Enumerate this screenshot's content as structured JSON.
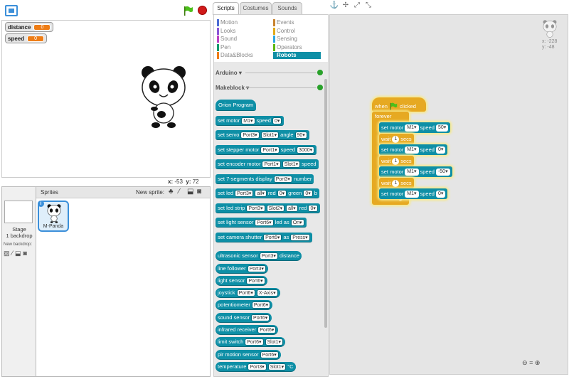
{
  "stage": {
    "variables": [
      {
        "name": "distance",
        "value": "0"
      },
      {
        "name": "speed",
        "value": "0"
      }
    ],
    "coords": {
      "x_label": "x:",
      "x": "-53",
      "y_label": "y:",
      "y": "72"
    }
  },
  "sprites": {
    "header": "Sprites",
    "new_sprite_label": "New sprite:",
    "stage_label_1": "Stage",
    "stage_label_2": "1 backdrop",
    "new_backdrop_label": "New backdrop:",
    "items": [
      {
        "name": "M-Panda"
      }
    ],
    "info_badge": "i"
  },
  "tabs": {
    "scripts": "Scripts",
    "costumes": "Costumes",
    "sounds": "Sounds"
  },
  "categories": {
    "left": [
      {
        "label": "Motion",
        "color": "#4a6cd4"
      },
      {
        "label": "Looks",
        "color": "#8a55d7"
      },
      {
        "label": "Sound",
        "color": "#bb42c3"
      },
      {
        "label": "Pen",
        "color": "#0e9a6c"
      },
      {
        "label": "Data&Blocks",
        "color": "#ee7d16"
      }
    ],
    "right": [
      {
        "label": "Events",
        "color": "#c88330"
      },
      {
        "label": "Control",
        "color": "#e1a91a"
      },
      {
        "label": "Sensing",
        "color": "#2ca5e2"
      },
      {
        "label": "Operators",
        "color": "#5cb712"
      },
      {
        "label": "Robots",
        "color": "#0e8fa6"
      }
    ]
  },
  "extensions": {
    "arduino": "Arduino ▾",
    "makeblock": "Makeblock ▾"
  },
  "palette": {
    "orion": "Orion Program",
    "b1": {
      "t1": "set motor",
      "s1": "M1▾",
      "t2": "speed",
      "s2": "0▾"
    },
    "b2": {
      "t1": "set servo",
      "s1": "Port3▾",
      "s2": "Slot1▾",
      "t2": "angle",
      "s3": "90▾"
    },
    "b3": {
      "t1": "set stepper motor",
      "s1": "Port1▾",
      "t2": "speed",
      "s2": "3000▾"
    },
    "b4": {
      "t1": "set encoder motor",
      "s1": "Port1▾",
      "s2": "Slot1▾",
      "t2": "speed"
    },
    "b5": {
      "t1": "set 7-segments display",
      "s1": "Port3▾",
      "t2": "number"
    },
    "b6": {
      "t1": "set led",
      "s1": "Port3▾",
      "s2": "all▾",
      "t2": "red",
      "s3": "0▾",
      "t3": "green",
      "s4": "0▾",
      "t4": "b"
    },
    "b7": {
      "t1": "set led strip",
      "s1": "Port3▾",
      "s2": "Slot2▾",
      "s3": "all▾",
      "t2": "red",
      "s4": "0▾"
    },
    "b8": {
      "t1": "set light sensor",
      "s1": "Port6▾",
      "t2": "led as",
      "s2": "On▾"
    },
    "b9": {
      "t1": "set camera shutter",
      "s1": "Port6▾",
      "t2": "as",
      "s2": "Press▾"
    },
    "r1": {
      "t1": "ultrasonic sensor",
      "s1": "Port3▾",
      "t2": "distance"
    },
    "r2": {
      "t1": "line follower",
      "s1": "Port3▾"
    },
    "r3": {
      "t1": "light sensor",
      "s1": "Port6▾"
    },
    "r4": {
      "t1": "joystick",
      "s1": "Port6▾",
      "s2": "X-Axis▾"
    },
    "r5": {
      "t1": "potentiometer",
      "s1": "Port6▾"
    },
    "r6": {
      "t1": "sound sensor",
      "s1": "Port6▾"
    },
    "r7": {
      "t1": "infrared receiver",
      "s1": "Port6▾"
    },
    "r8": {
      "t1": "limit switch",
      "s1": "Port6▾",
      "s2": "Slot1▾"
    },
    "r9": {
      "t1": "pir motion sensor",
      "s1": "Port6▾"
    },
    "r10": {
      "t1": "temperature",
      "s1": "Port3▾",
      "s2": "Slot1▾",
      "t2": "°C"
    }
  },
  "script": {
    "hat": {
      "t1": "when",
      "t2": "clicked"
    },
    "forever": "forever",
    "steps": [
      {
        "kind": "motor",
        "t1": "set motor",
        "s1": "M1▾",
        "t2": "speed",
        "s2": "50▾"
      },
      {
        "kind": "wait",
        "t1": "wait",
        "s1": "1",
        "t2": "secs"
      },
      {
        "kind": "motor",
        "t1": "set motor",
        "s1": "M1▾",
        "t2": "speed",
        "s2": "0▾"
      },
      {
        "kind": "wait",
        "t1": "wait",
        "s1": "1",
        "t2": "secs"
      },
      {
        "kind": "motor",
        "t1": "set motor",
        "s1": "M1▾",
        "t2": "speed",
        "s2": "-50▾"
      },
      {
        "kind": "wait",
        "t1": "wait",
        "s1": "1",
        "t2": "secs"
      },
      {
        "kind": "motor",
        "t1": "set motor",
        "s1": "M1▾",
        "t2": "speed",
        "s2": "0▾"
      }
    ]
  },
  "scripts_area": {
    "pos_x": "x: -228",
    "pos_y": "y: -48",
    "zoom_out": "⊖",
    "zoom_reset": "=",
    "zoom_in": "⊕"
  },
  "colors": {
    "robots": "#0e8fa6",
    "control": "#e6a922",
    "accent": "#3b8fd9"
  }
}
